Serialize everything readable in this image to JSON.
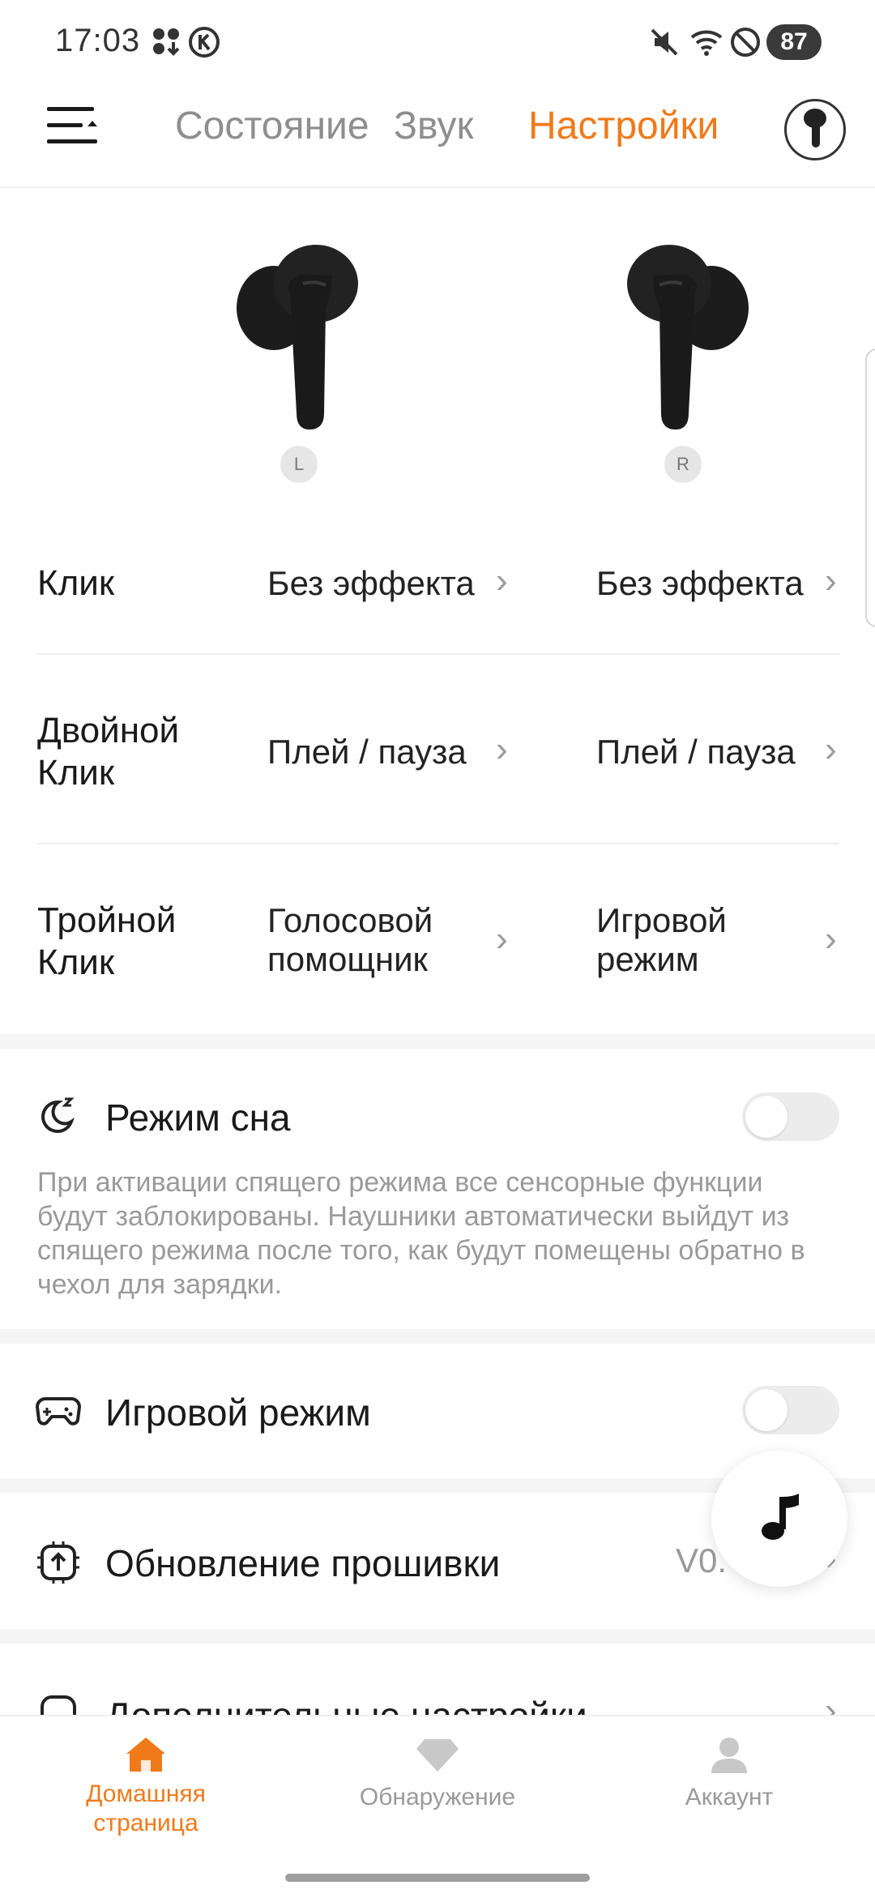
{
  "status_bar": {
    "time": "17:03",
    "battery": "87",
    "icons": [
      "notification-apps-icon",
      "k-badge-icon",
      "mute-icon",
      "wifi-icon",
      "do-not-disturb-icon"
    ]
  },
  "header": {
    "tabs": [
      {
        "label": "Состояние",
        "active": false
      },
      {
        "label": "Звук",
        "active": false
      },
      {
        "label": "Настройки",
        "active": true
      }
    ],
    "accent_color": "#f07a1a"
  },
  "earbuds": {
    "left_label": "L",
    "right_label": "R"
  },
  "gestures": [
    {
      "label": "Клик",
      "left": "Без эффекта",
      "right": "Без эффекта"
    },
    {
      "label_line1": "Двойной",
      "label_line2": "Клик",
      "left": "Плей / пауза",
      "right": "Плей / пауза"
    },
    {
      "label_line1": "Тройной",
      "label_line2": "Клик",
      "left_line1": "Голосовой",
      "left_line2": "помощник",
      "right_line1": "Игровой",
      "right_line2": "режим"
    }
  ],
  "sleep_mode": {
    "title": "Режим сна",
    "enabled": false,
    "description": "При активации спящего режима все сенсорные функции будут заблокированы. Наушники автоматически выйдут из спящего режима после того, как будут помещены обратно в чехол для зарядки."
  },
  "game_mode": {
    "title": "Игровой режим",
    "enabled": false
  },
  "firmware": {
    "title": "Обновление прошивки",
    "version": "V0."
  },
  "advanced": {
    "title": "Дополнительные настройки"
  },
  "bottom_nav": [
    {
      "label_line1": "Домашняя",
      "label_line2": "страница",
      "active": true
    },
    {
      "label": "Обнаружение",
      "active": false
    },
    {
      "label": "Аккаунт",
      "active": false
    }
  ]
}
